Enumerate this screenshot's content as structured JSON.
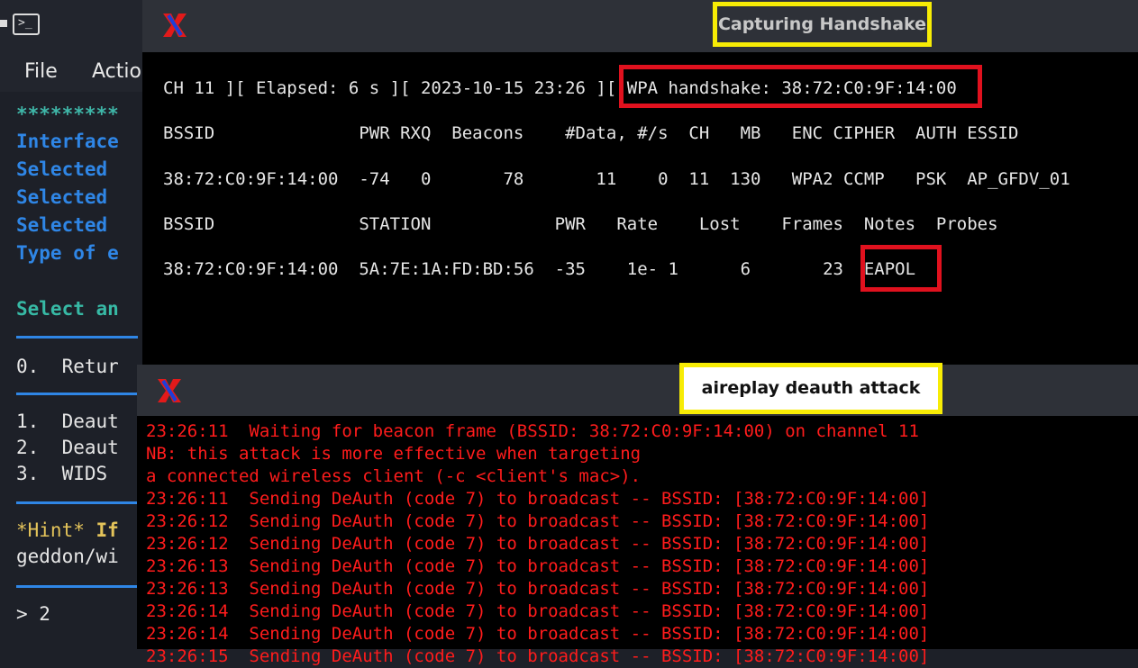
{
  "background_terminal": {
    "menu": {
      "file": "File",
      "actions": "Actio"
    },
    "lines": {
      "stars": "*********",
      "interface": "Interface",
      "selected1": "Selected",
      "selected2": "Selected",
      "selected3": "Selected",
      "type": "Type of e",
      "select_prompt": "Select an",
      "option0": "0.  Retur",
      "option1": "1.  Deaut",
      "option2": "2.  Deaut",
      "option3": "3.  WIDS ",
      "hint_prefix": "*Hint* ",
      "hint_bold": "If",
      "hint_line2": "geddon/wi",
      "input": "> 2"
    }
  },
  "dump_window": {
    "title": "Capturing Handshake",
    "status_prefix": "CH 11 ][ Elapsed: 6 s ][ 2023-10-15 23:26 ][ ",
    "handshake": "WPA handshake: 38:72:C0:9F:14:00",
    "ap_header": "BSSID              PWR RXQ  Beacons    #Data, #/s  CH   MB   ENC CIPHER  AUTH ESSID",
    "ap_row": "38:72:C0:9F:14:00  -74   0       78       11    0  11  130   WPA2 CCMP   PSK  AP_GFDV_01",
    "station_header": "BSSID              STATION            PWR   Rate    Lost    Frames  Notes  Probes",
    "station_row_prefix": "38:72:C0:9F:14:00  5A:7E:1A:FD:BD:56  -35    1e- 1      6       23  ",
    "notes": "EAPOL"
  },
  "replay_window": {
    "title": "aireplay deauth attack",
    "log": [
      "23:26:11  Waiting for beacon frame (BSSID: 38:72:C0:9F:14:00) on channel 11",
      "NB: this attack is more effective when targeting",
      "a connected wireless client (-c <client's mac>).",
      "23:26:11  Sending DeAuth (code 7) to broadcast -- BSSID: [38:72:C0:9F:14:00]",
      "23:26:12  Sending DeAuth (code 7) to broadcast -- BSSID: [38:72:C0:9F:14:00]",
      "23:26:12  Sending DeAuth (code 7) to broadcast -- BSSID: [38:72:C0:9F:14:00]",
      "23:26:13  Sending DeAuth (code 7) to broadcast -- BSSID: [38:72:C0:9F:14:00]",
      "23:26:13  Sending DeAuth (code 7) to broadcast -- BSSID: [38:72:C0:9F:14:00]",
      "23:26:14  Sending DeAuth (code 7) to broadcast -- BSSID: [38:72:C0:9F:14:00]",
      "23:26:14  Sending DeAuth (code 7) to broadcast -- BSSID: [38:72:C0:9F:14:00]",
      "23:26:15  Sending DeAuth (code 7) to broadcast -- BSSID: [38:72:C0:9F:14:00]"
    ]
  },
  "colors": {
    "highlight_yellow": "#f7ec05",
    "highlight_red": "#e0111e",
    "log_red": "#ff1c1c"
  },
  "icons": {
    "terminal_app": "terminal-icon",
    "xterm": "xterm-x-icon"
  }
}
